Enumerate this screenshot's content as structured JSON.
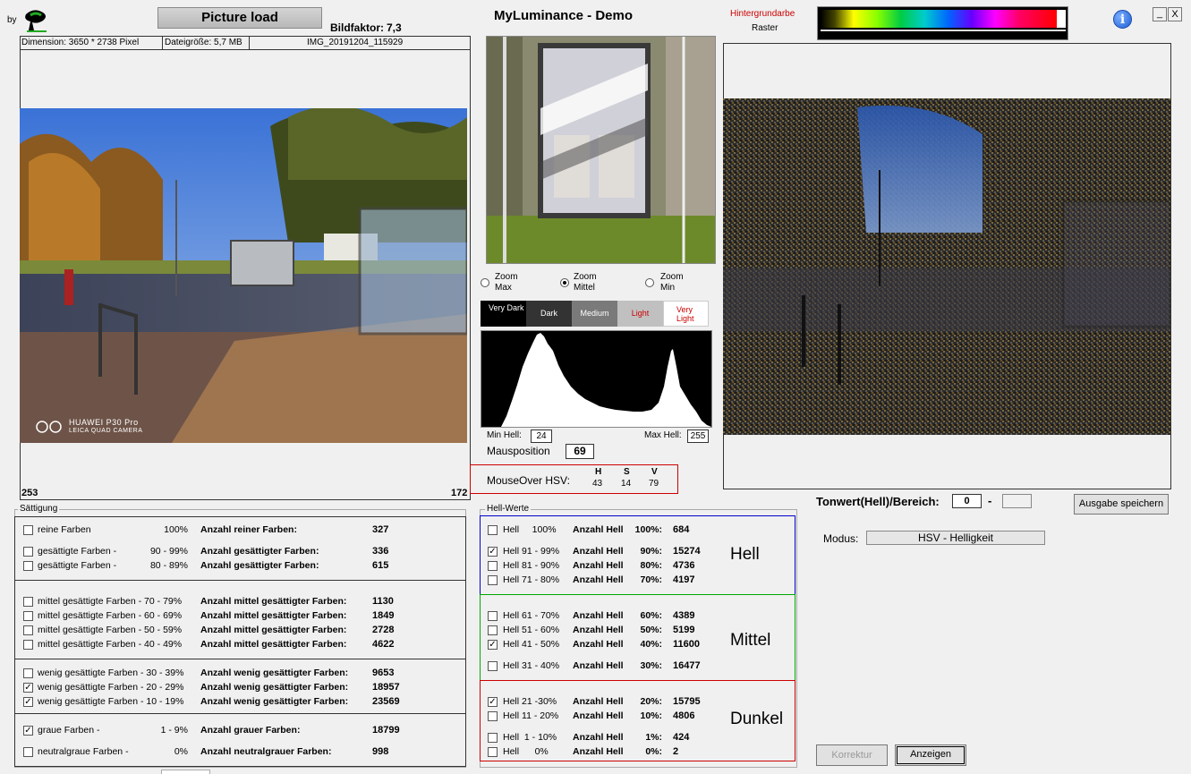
{
  "header": {
    "by": "by",
    "load_button": "Picture load",
    "bildfaktor_label": "Bildfaktor:",
    "bildfaktor_value": "7,3",
    "app_title": "MyLuminance - Demo",
    "hintergrund_label": "Hintergrundarbe",
    "raster_label": "Raster",
    "info_icon": "info-icon",
    "minimize_label": "_",
    "close_label": "X"
  },
  "fileinfo": {
    "dimension": "Dimension: 3650 * 2738 Pixel",
    "size": "Dateigröße: 5,7 MB",
    "name": "IMG_20191204_115929"
  },
  "left_image": {
    "watermark1": "HUAWEI P30 Pro",
    "watermark2": "LEICA QUAD CAMERA",
    "corner_left": "253",
    "corner_right": "172"
  },
  "zoom": {
    "options": [
      "Zoom Max",
      "Zoom Mittel",
      "Zoom Min"
    ],
    "selected": 1
  },
  "tone_bar": {
    "labels": [
      "Very Dark",
      "Dark",
      "Medium",
      "Light",
      "Very Light"
    ]
  },
  "histogram": {
    "min_label": "Min Hell:",
    "min_value": "24",
    "max_label": "Max Hell:",
    "max_value": "255",
    "mauspos_label": "Mausposition",
    "mauspos_value": "69"
  },
  "mouseover": {
    "label": "MouseOver HSV:",
    "h_label": "H",
    "h": "43",
    "s_label": "S",
    "s": "14",
    "v_label": "V",
    "v": "79"
  },
  "tonwert": {
    "label": "Tonwert(Hell)/Bereich:",
    "from": "0",
    "dash": "-",
    "to": "",
    "save_button": "Ausgabe speichern",
    "modus_label": "Modus:",
    "modus_value": "HSV - Helligkeit",
    "korrektur_button": "Korrektur",
    "anzeigen_button": "Anzeigen"
  },
  "saettigung": {
    "legend": "Sättigung",
    "rows": [
      {
        "checked": false,
        "label": "reine Farben",
        "range": "100%",
        "desc": "Anzahl reiner Farben:",
        "count": "327"
      },
      {
        "checked": false,
        "label": "gesättigte Farben  -",
        "range": "90 - 99%",
        "desc": "Anzahl gesättigter Farben:",
        "count": "336"
      },
      {
        "checked": false,
        "label": "gesättigte Farben  -",
        "range": "80 - 89%",
        "desc": "Anzahl gesättigter Farben:",
        "count": "615"
      },
      {
        "checked": false,
        "label": "mittel gesättigte Farben  - 70 - 79%",
        "range": "",
        "desc": "Anzahl mittel gesättigter Farben:",
        "count": "1130"
      },
      {
        "checked": false,
        "label": "mittel gesättigte Farben  - 60 - 69%",
        "range": "",
        "desc": "Anzahl mittel gesättigter Farben:",
        "count": "1849"
      },
      {
        "checked": false,
        "label": "mittel gesättigte Farben  - 50 - 59%",
        "range": "",
        "desc": "Anzahl mittel gesättigter Farben:",
        "count": "2728"
      },
      {
        "checked": false,
        "label": "mittel gesättigte Farben  - 40 - 49%",
        "range": "",
        "desc": "Anzahl mittel gesättigter Farben:",
        "count": "4622"
      },
      {
        "checked": false,
        "label": "wenig gesättigte Farben  - 30 - 39%",
        "range": "",
        "desc": "Anzahl wenig gesättigter Farben:",
        "count": "9653"
      },
      {
        "checked": true,
        "label": "wenig gesättigte Farben  - 20 - 29%",
        "range": "",
        "desc": "Anzahl wenig gesättigter Farben:",
        "count": "18957"
      },
      {
        "checked": true,
        "label": "wenig gesättigte Farben  - 10 - 19%",
        "range": "",
        "desc": "Anzahl wenig gesättigter Farben:",
        "count": "23569"
      },
      {
        "checked": true,
        "label": "graue Farben  -",
        "range": "1 -  9%",
        "desc": "Anzahl grauer Farben:",
        "count": "18799"
      },
      {
        "checked": false,
        "label": "neutralgraue Farben  -",
        "range": "0%",
        "desc": "Anzahl neutralgrauer Farben:",
        "count": "998"
      }
    ]
  },
  "hellwerte": {
    "legend": "Hell-Werte",
    "group_hell": "Hell",
    "group_mittel": "Mittel",
    "group_dunkel": "Dunkel",
    "rows": [
      {
        "checked": false,
        "label": "Hell     100%",
        "desc": "Anzahl Hell",
        "pct": "100%:",
        "count": "684"
      },
      {
        "checked": true,
        "label": "Hell 91 - 99%",
        "desc": "Anzahl Hell",
        "pct": "90%:",
        "count": "15274"
      },
      {
        "checked": false,
        "label": "Hell 81 - 90%",
        "desc": "Anzahl Hell",
        "pct": "80%:",
        "count": "4736"
      },
      {
        "checked": false,
        "label": "Hell 71 - 80%",
        "desc": "Anzahl Hell",
        "pct": "70%:",
        "count": "4197"
      },
      {
        "checked": false,
        "label": "Hell 61 - 70%",
        "desc": "Anzahl Hell",
        "pct": "60%:",
        "count": "4389"
      },
      {
        "checked": false,
        "label": "Hell 51 - 60%",
        "desc": "Anzahl Hell",
        "pct": "50%:",
        "count": "5199"
      },
      {
        "checked": true,
        "label": "Hell 41 - 50%",
        "desc": "Anzahl Hell",
        "pct": "40%:",
        "count": "11600"
      },
      {
        "checked": false,
        "label": "Hell 31 - 40%",
        "desc": "Anzahl Hell",
        "pct": "30%:",
        "count": "16477"
      },
      {
        "checked": true,
        "label": "Hell 21 -30%",
        "desc": "Anzahl Hell",
        "pct": "20%:",
        "count": "15795"
      },
      {
        "checked": false,
        "label": "Hell 11 - 20%",
        "desc": "Anzahl Hell",
        "pct": "10%:",
        "count": "4806"
      },
      {
        "checked": false,
        "label": "Hell  1 - 10%",
        "desc": "Anzahl Hell",
        "pct": "1%:",
        "count": "424"
      },
      {
        "checked": false,
        "label": "Hell      0%",
        "desc": "Anzahl Hell",
        "pct": "0%:",
        "count": "2"
      }
    ]
  },
  "colors": {
    "accent_red": "#cc0000",
    "hell_border": "#0000cc",
    "mittel_border": "#00aa00",
    "dunkel_border": "#cc0000"
  }
}
